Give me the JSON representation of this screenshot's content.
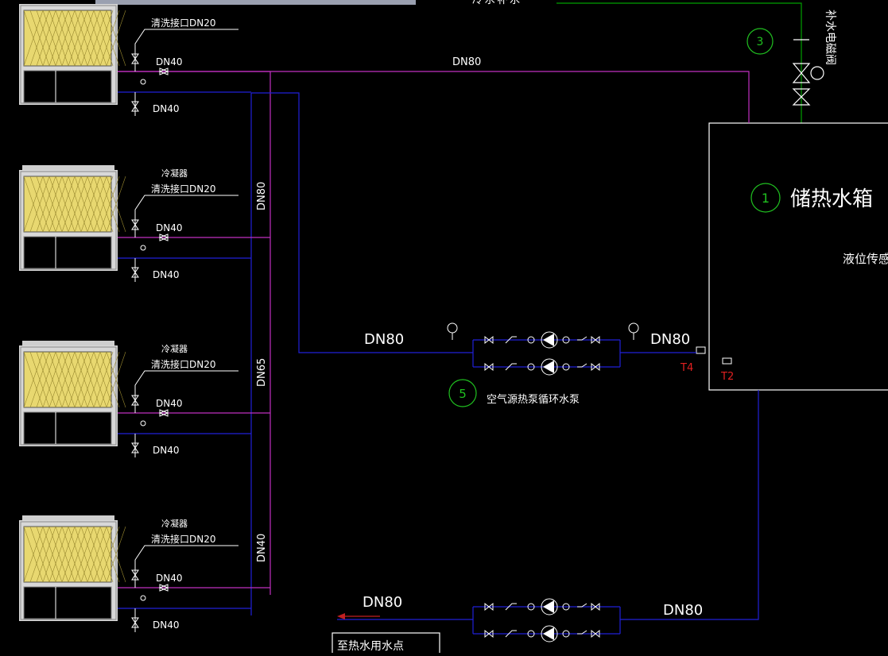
{
  "colors": {
    "background": "#000000",
    "supply_line": "#c030c0",
    "return_line": "#2020d8",
    "makeup_line": "#00a000",
    "label": "#ffffff",
    "sensor_label": "#e02020",
    "callout": "#20c020",
    "unit_grille": "#e8d870"
  },
  "top_cut_label": "冷水补水",
  "makeup_valve_label": "补水电磁阀",
  "units": [
    {
      "condenser": "",
      "flush": "清洗接口DN20",
      "supply": "DN40",
      "return": "DN40"
    },
    {
      "condenser": "冷凝器",
      "flush": "清洗接口DN20",
      "supply": "DN40",
      "return": "DN40"
    },
    {
      "condenser": "冷凝器",
      "flush": "清洗接口DN20",
      "supply": "DN40",
      "return": "DN40"
    },
    {
      "condenser": "冷凝器",
      "flush": "清洗接口DN20",
      "supply": "DN40",
      "return": "DN40"
    }
  ],
  "risers": [
    "DN80",
    "DN65",
    "DN40"
  ],
  "main_header": "DN80",
  "tank": {
    "number": "1",
    "name": "储热水箱",
    "level_sensor": "液位传感器"
  },
  "valve_callout": "3",
  "pump_group": {
    "number": "5",
    "name": "空气源热泵循环水泵",
    "inlet": "DN80",
    "outlet": "DN80"
  },
  "sensors": [
    "T4",
    "T2"
  ],
  "hot_water_pumps": {
    "inlet": "DN80",
    "outlet": "DN80"
  },
  "outlet_box": "至热水用水点"
}
